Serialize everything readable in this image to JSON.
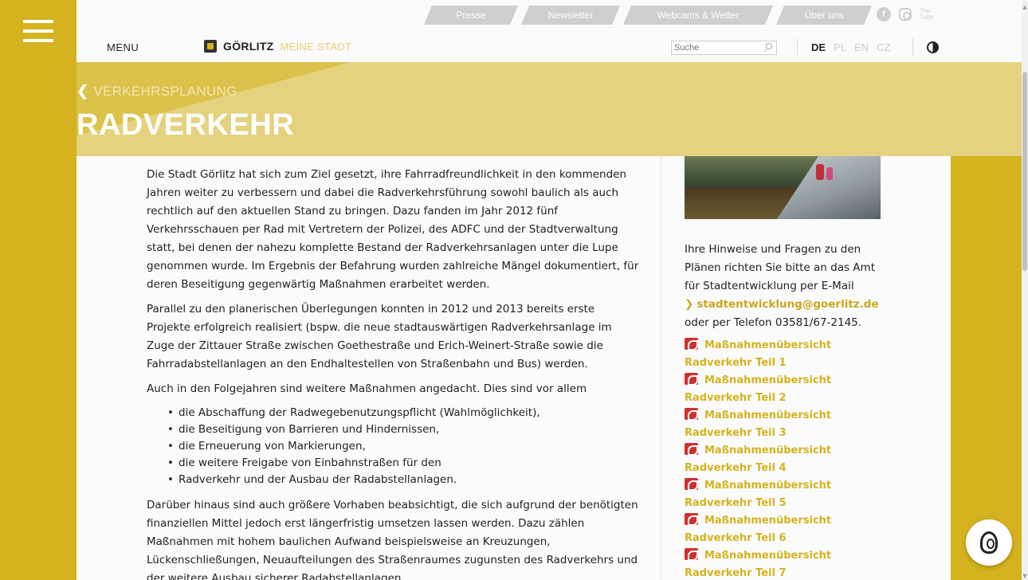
{
  "header": {
    "menu_label": "MENU",
    "logo_name": "GÖRLITZ",
    "logo_sub": "MEINE STADT",
    "top_tabs": [
      "Presse",
      "Newsletter",
      "Webcams & Wetter",
      "Über uns"
    ],
    "social": [
      "facebook-icon",
      "instagram-icon",
      "youtube-icon"
    ],
    "youtube_text": "You Tube",
    "search_placeholder": "Suche",
    "languages": [
      "DE",
      "PL",
      "EN",
      "CZ"
    ],
    "active_language": "DE"
  },
  "hero": {
    "back_label": "VERKEHRSPLANUNG",
    "title": "RADVERKEHR"
  },
  "main": {
    "p1": "Die Stadt Görlitz hat sich zum Ziel gesetzt, ihre Fahrradfreundlichkeit in den kommenden Jahren weiter zu verbessern und dabei die Radverkehrsführung sowohl baulich als auch rechtlich auf den aktuellen Stand zu bringen. Dazu fanden im Jahr 2012 fünf Verkehrsschauen per Rad mit Vertretern der Polizei, des ADFC und der Stadtverwaltung statt, bei denen der nahezu komplette Bestand der Radverkehrsanlagen unter die Lupe genommen wurde. Im Ergebnis der Befahrung wurden zahlreiche Mängel dokumentiert, für deren Beseitigung gegenwärtig Maßnahmen erarbeitet werden.",
    "p2": "Parallel zu den planerischen Überlegungen konnten in 2012 und 2013 bereits erste Projekte erfolgreich realisiert (bspw. die neue stadtauswärtigen Radverkehrsanlage im Zuge der Zittauer Straße zwischen Goethestraße und Erich-Weinert-Straße sowie die Fahrradabstellanlagen an den Endhaltestellen von Straßenbahn und Bus) werden.",
    "p3": "Auch in den Folgejahren sind weitere Maßnahmen angedacht. Dies sind vor allem",
    "list": [
      "die Abschaffung der Radwegebenutzungspflicht (Wahlmöglichkeit),",
      "die Beseitigung von Barrieren und Hindernissen,",
      "die Erneuerung von Markierungen,",
      "die weitere Freigabe von Einbahnstraßen für den",
      "Radverkehr und der Ausbau der Radabstellanlagen."
    ],
    "p4": "Darüber hinaus sind auch größere Vorhaben beabsichtigt, die sich aufgrund der benötigten finanziellen Mittel jedoch erst längerfristig umsetzen lassen werden. Dazu zählen Maßnahmen mit hohem baulichen Aufwand beispielsweise an Kreuzungen, Lückenschließungen, Neuaufteilungen des Straßenraumes zugunsten des Radverkehrs und der weitere Ausbau sicherer Radabstellanlagen."
  },
  "sidebar": {
    "contact_text": "Ihre Hinweise und Fragen zu den Plänen richten Sie bitte an das Amt für Stadtentwicklung per E-Mail",
    "email": "stadtentwicklung@goerlitz.de",
    "phone_text": "oder per Telefon 03581/67-2145.",
    "docs": [
      {
        "line1": "Maßnahmenübersicht",
        "line2": "Radverkehr Teil 1"
      },
      {
        "line1": "Maßnahmenübersicht",
        "line2": "Radverkehr Teil 2"
      },
      {
        "line1": "Maßnahmenübersicht",
        "line2": "Radverkehr Teil 3"
      },
      {
        "line1": "Maßnahmenübersicht",
        "line2": "Radverkehr Teil 4"
      },
      {
        "line1": "Maßnahmenübersicht",
        "line2": "Radverkehr Teil 5"
      },
      {
        "line1": "Maßnahmenübersicht",
        "line2": "Radverkehr Teil 6"
      },
      {
        "line1": "Maßnahmenübersicht",
        "line2": "Radverkehr Teil 7"
      }
    ]
  },
  "colors": {
    "gold": "#d4b31f",
    "hero_light": "#e5d27f",
    "link_gold": "#d4b31f",
    "pdf_red": "#d32f2f"
  }
}
